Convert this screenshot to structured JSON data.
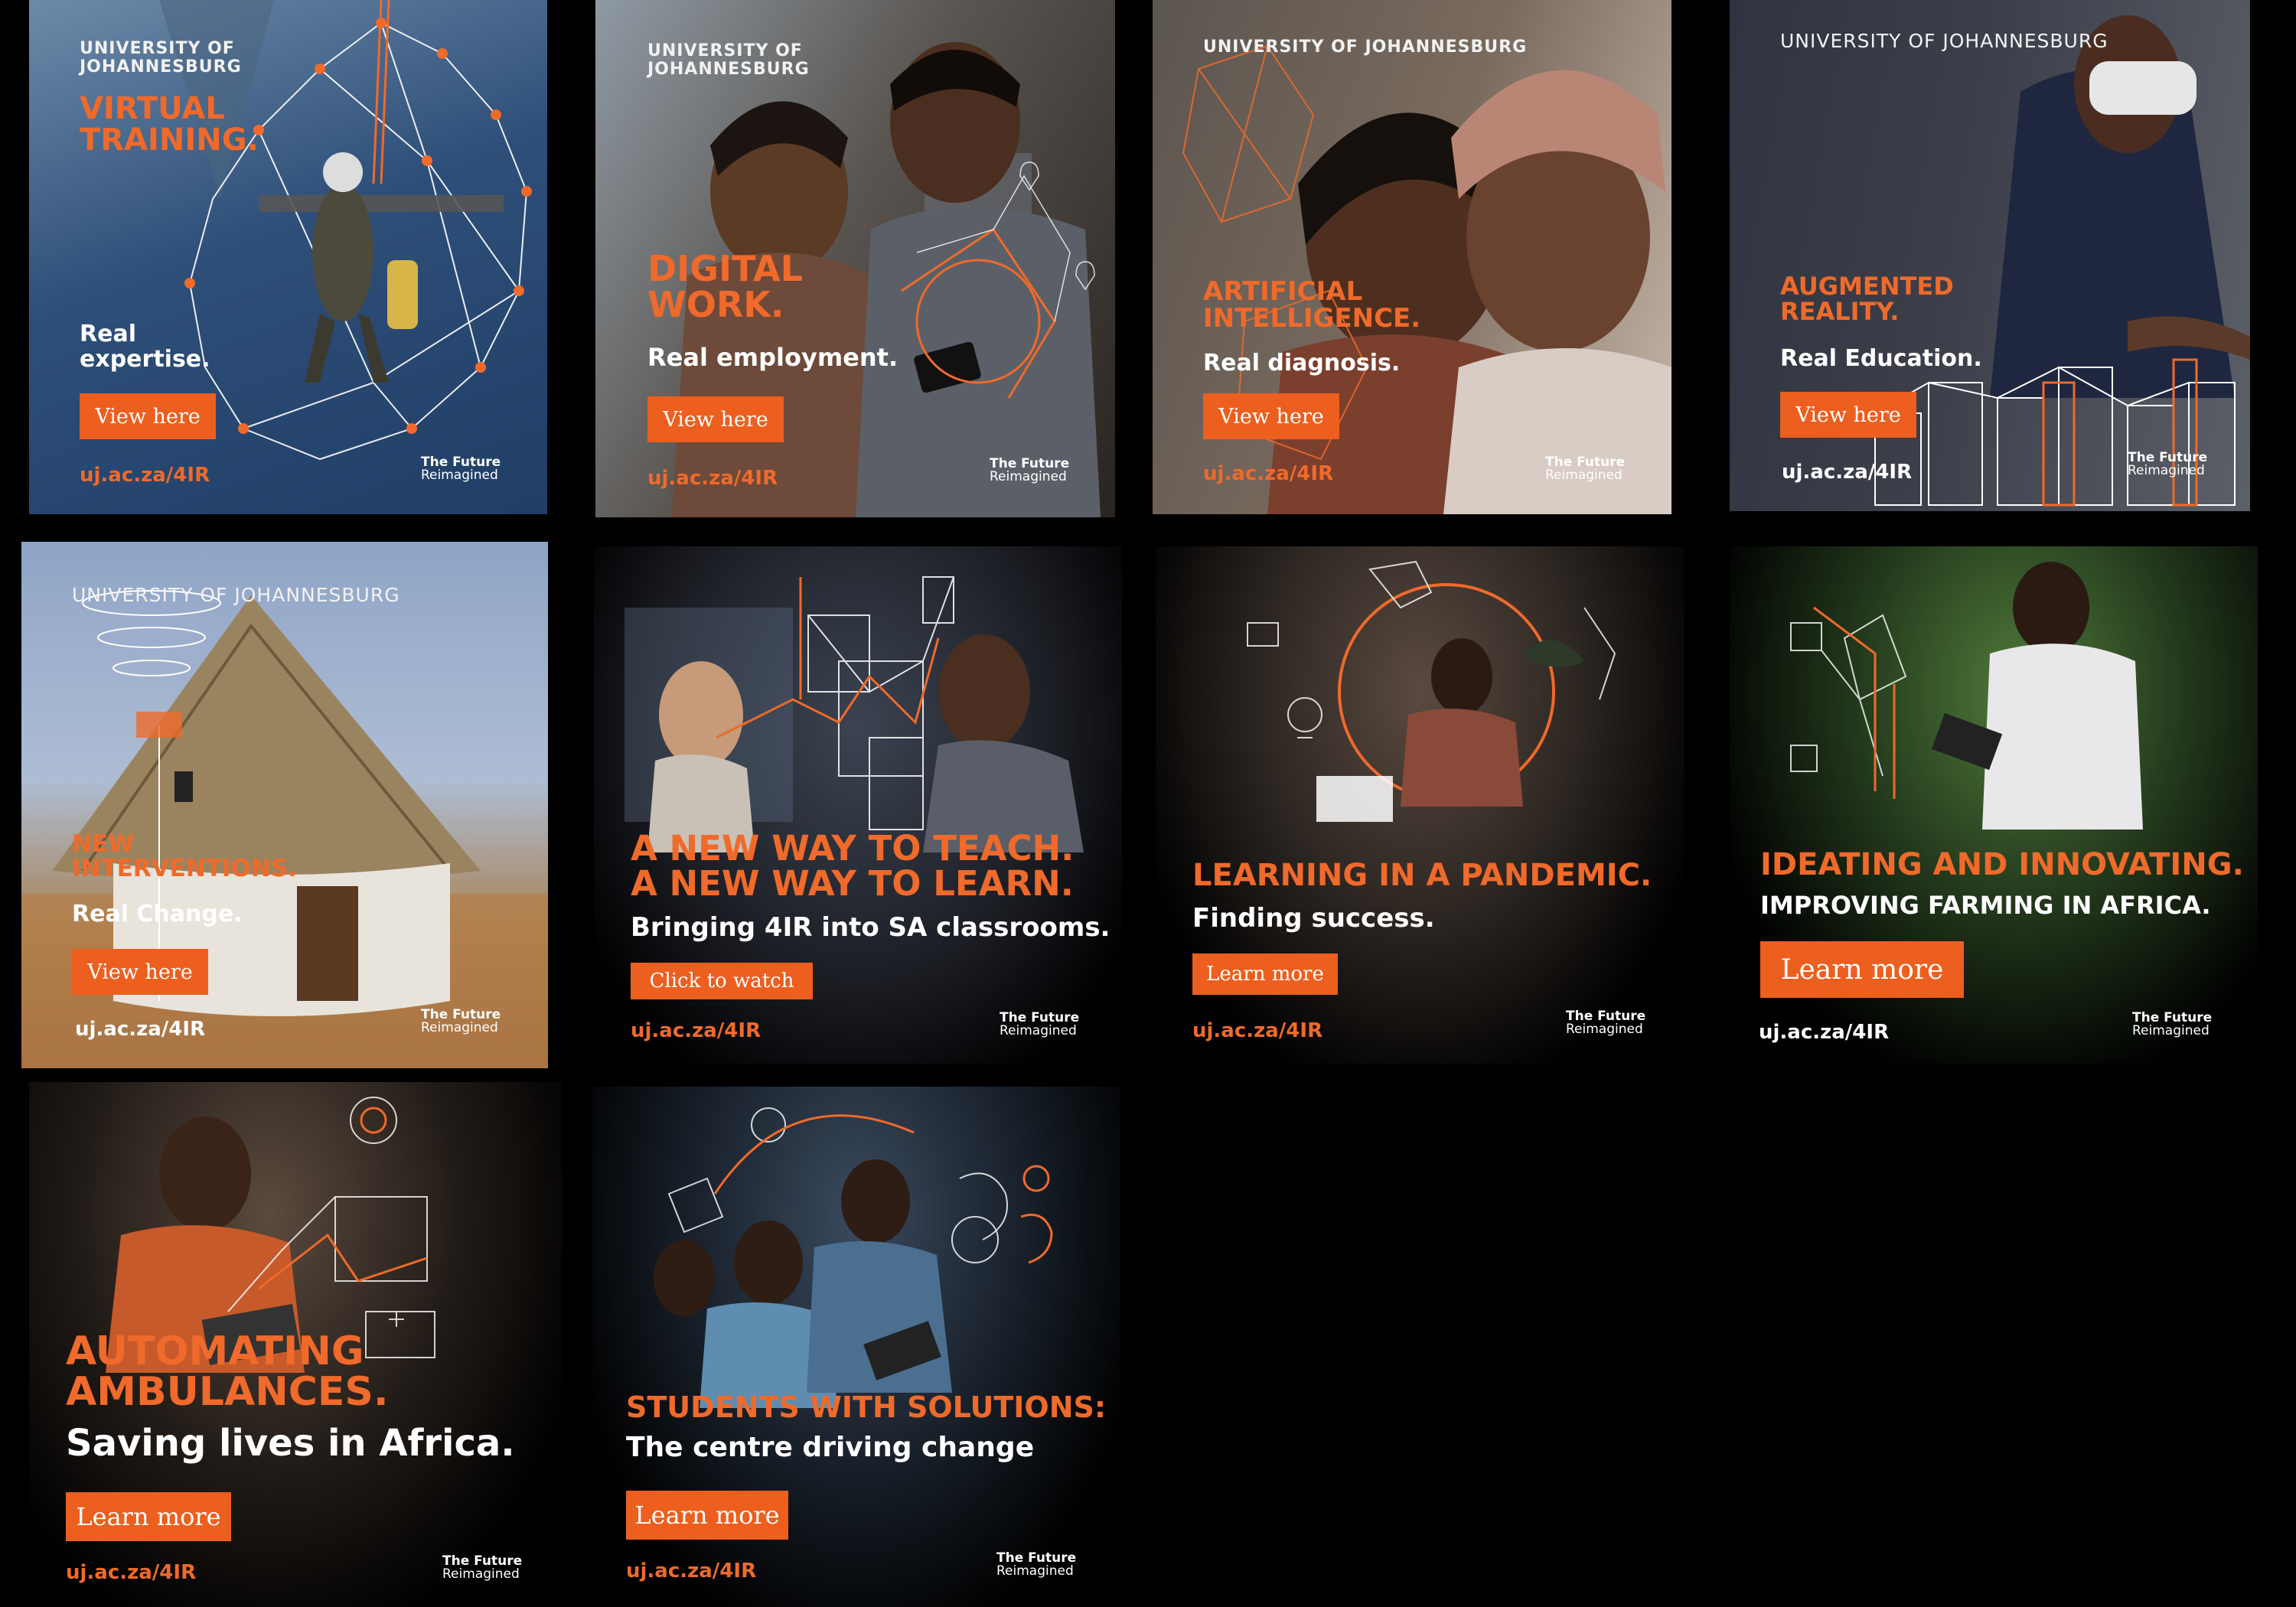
{
  "brand": {
    "university": "UNIVERSITY OF JOHANNESBURG",
    "university_line1": "UNIVERSITY OF",
    "university_line2": "JOHANNESBURG",
    "tagline_line1": "The Future",
    "tagline_line2": "Reimagined",
    "url": "uj.ac.za/4IR",
    "accent_color": "#ec5f1e"
  },
  "ads": [
    {
      "id": "virtual-training",
      "headline_line1": "VIRTUAL",
      "headline_line2": "TRAINING.",
      "subline_line1": "Real",
      "subline_line2": "expertise.",
      "button": "View here"
    },
    {
      "id": "digital-work",
      "headline_line1": "DIGITAL",
      "headline_line2": "WORK.",
      "subline": "Real employment.",
      "button": "View here"
    },
    {
      "id": "artificial-intelligence",
      "headline_line1": "ARTIFICIAL",
      "headline_line2": "INTELLIGENCE.",
      "subline": "Real diagnosis.",
      "button": "View here"
    },
    {
      "id": "augmented-reality",
      "headline_line1": "AUGMENTED",
      "headline_line2": "REALITY.",
      "subline": "Real Education.",
      "button": "View here"
    },
    {
      "id": "new-interventions",
      "headline_line1": "NEW",
      "headline_line2": "INTERVENTIONS.",
      "subline": "Real Change.",
      "button": "View here"
    },
    {
      "id": "new-way-to-teach",
      "headline_line1": "A NEW WAY TO TEACH.",
      "headline_line2": "A NEW WAY TO LEARN.",
      "subline": "Bringing 4IR into SA classrooms.",
      "button": "Click to watch"
    },
    {
      "id": "learning-in-pandemic",
      "headline": "LEARNING IN A PANDEMIC.",
      "subline": "Finding success.",
      "button": "Learn more"
    },
    {
      "id": "ideating-innovating",
      "headline": "IDEATING AND INNOVATING.",
      "subline": "IMPROVING FARMING IN AFRICA.",
      "button": "Learn more"
    },
    {
      "id": "automating-ambulances",
      "headline_line1": "AUTOMATING",
      "headline_line2": "AMBULANCES.",
      "subline": "Saving lives in Africa.",
      "button": "Learn more"
    },
    {
      "id": "students-with-solutions",
      "headline": "STUDENTS WITH SOLUTIONS:",
      "subline": "The centre driving change",
      "button": "Learn more"
    }
  ]
}
